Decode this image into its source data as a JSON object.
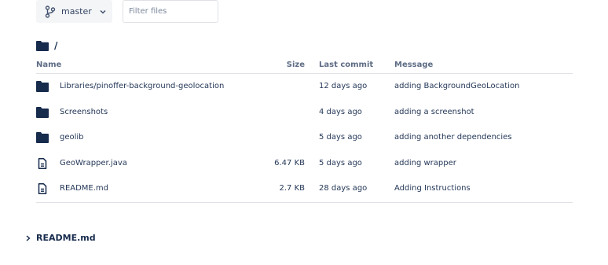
{
  "toolbar": {
    "branch_label": "master",
    "filter_placeholder": "Filter files"
  },
  "breadcrumb": {
    "path": "/"
  },
  "table": {
    "columns": {
      "name": "Name",
      "size": "Size",
      "last_commit": "Last commit",
      "message": "Message"
    },
    "rows": [
      {
        "type": "folder",
        "name": "Libraries/pinoffer-background-geolocation",
        "size": "",
        "last_commit": "12 days ago",
        "message": "adding BackgroundGeoLocation"
      },
      {
        "type": "folder",
        "name": "Screenshots",
        "size": "",
        "last_commit": "4 days ago",
        "message": "adding a screenshot"
      },
      {
        "type": "folder",
        "name": "geolib",
        "size": "",
        "last_commit": "5 days ago",
        "message": "adding another dependencies"
      },
      {
        "type": "file",
        "name": "GeoWrapper.java",
        "size": "6.47 KB",
        "last_commit": "5 days ago",
        "message": "adding wrapper"
      },
      {
        "type": "file",
        "name": "README.md",
        "size": "2.7 KB",
        "last_commit": "28 days ago",
        "message": "Adding Instructions"
      }
    ]
  },
  "readme_section": {
    "label": "README.md"
  },
  "icons": {
    "folder": "folder-icon",
    "file": "file-icon",
    "branch": "branch-icon",
    "chevron": "chevron-down-icon",
    "caret": "caret-right-icon"
  },
  "colors": {
    "folder": "#172b4d",
    "text": "#253858",
    "header": "#5e6c84",
    "border": "#dfe1e6",
    "button_bg": "#f4f5f7"
  }
}
